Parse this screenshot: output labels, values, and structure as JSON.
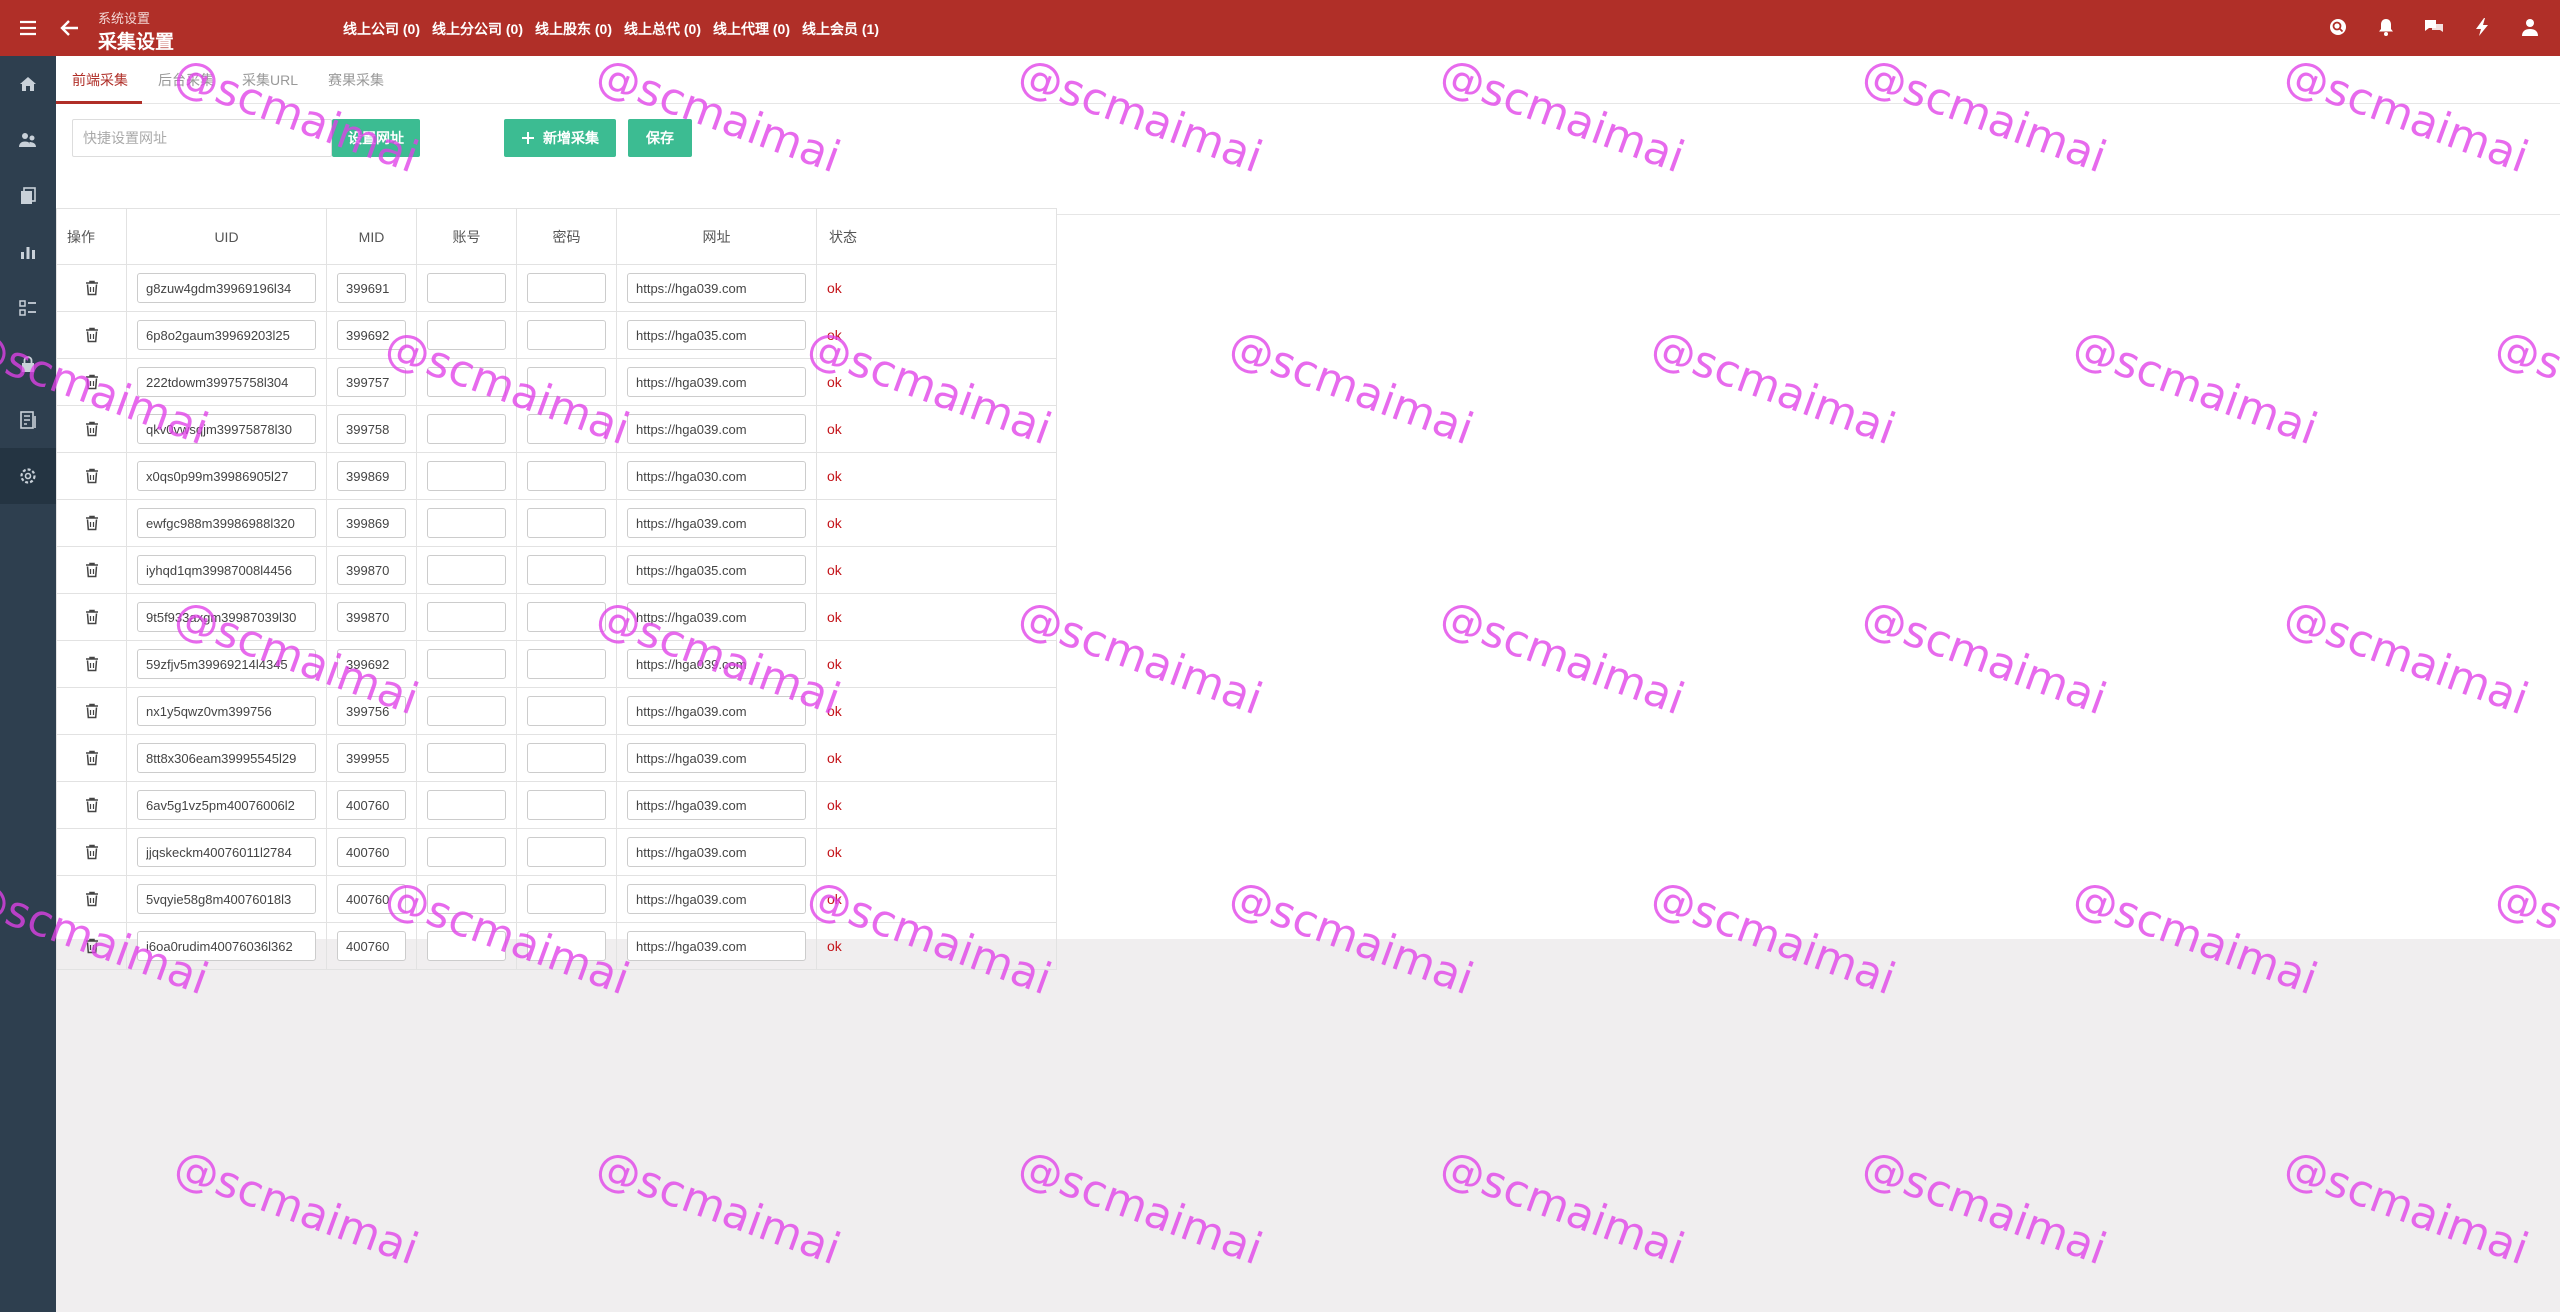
{
  "header": {
    "breadcrumb": "系统设置",
    "title": "采集设置",
    "counts": [
      "线上公司 (0)",
      "线上分公司 (0)",
      "线上股东 (0)",
      "线上总代 (0)",
      "线上代理 (0)",
      "线上会员 (1)"
    ],
    "icons": [
      "search-icon",
      "bell-icon",
      "chat-icon",
      "bolt-icon",
      "user-icon"
    ]
  },
  "sidebar": {
    "items": [
      "home-icon",
      "users-icon",
      "copy-icon",
      "chart-icon",
      "list-icon",
      "lock-icon",
      "book-icon",
      "settings-icon"
    ],
    "active_index": 7
  },
  "tabs": [
    {
      "label": "前端采集",
      "active": true
    },
    {
      "label": "后台采集",
      "active": false
    },
    {
      "label": "采集URL",
      "active": false
    },
    {
      "label": "赛果采集",
      "active": false
    }
  ],
  "toolbar": {
    "quick_url_placeholder": "快捷设置网址",
    "set_url_label": "设置网址",
    "add_label": "新增采集",
    "save_label": "保存"
  },
  "table": {
    "headers": [
      "操作",
      "UID",
      "MID",
      "账号",
      "密码",
      "网址",
      "状态"
    ],
    "rows": [
      {
        "uid": "g8zuw4gdm39969196l34",
        "mid": "399691",
        "account": "",
        "password": "",
        "url": "https://hga039.com",
        "status": "ok"
      },
      {
        "uid": "6p8o2gaum39969203l25",
        "mid": "399692",
        "account": "",
        "password": "",
        "url": "https://hga035.com",
        "status": "ok"
      },
      {
        "uid": "222tdowm39975758l304",
        "mid": "399757",
        "account": "",
        "password": "",
        "url": "https://hga039.com",
        "status": "ok"
      },
      {
        "uid": "qkv0vwsqjm39975878l30",
        "mid": "399758",
        "account": "",
        "password": "",
        "url": "https://hga039.com",
        "status": "ok"
      },
      {
        "uid": "x0qs0p99m39986905l27",
        "mid": "399869",
        "account": "",
        "password": "",
        "url": "https://hga030.com",
        "status": "ok"
      },
      {
        "uid": "ewfgc988m39986988l320",
        "mid": "399869",
        "account": "",
        "password": "",
        "url": "https://hga039.com",
        "status": "ok"
      },
      {
        "uid": "iyhqd1qm39987008l4456",
        "mid": "399870",
        "account": "",
        "password": "",
        "url": "https://hga035.com",
        "status": "ok"
      },
      {
        "uid": "9t5f933axgm39987039l30",
        "mid": "399870",
        "account": "",
        "password": "",
        "url": "https://hga039.com",
        "status": "ok"
      },
      {
        "uid": "59zfjv5m39969214l4345",
        "mid": "399692",
        "account": "",
        "password": "",
        "url": "https://hga039.com",
        "status": "ok"
      },
      {
        "uid": "nx1y5qwz0vm399756",
        "mid": "399756",
        "account": "",
        "password": "",
        "url": "https://hga039.com",
        "status": "ok"
      },
      {
        "uid": "8tt8x306eam39995545l29",
        "mid": "399955",
        "account": "",
        "password": "",
        "url": "https://hga039.com",
        "status": "ok"
      },
      {
        "uid": "6av5g1vz5pm40076006l2",
        "mid": "400760",
        "account": "",
        "password": "",
        "url": "https://hga039.com",
        "status": "ok"
      },
      {
        "uid": "jjqskeckm40076011l2784",
        "mid": "400760",
        "account": "",
        "password": "",
        "url": "https://hga039.com",
        "status": "ok"
      },
      {
        "uid": "5vqyie58g8m40076018l3",
        "mid": "400760",
        "account": "",
        "password": "",
        "url": "https://hga039.com",
        "status": "ok"
      },
      {
        "uid": "i6oa0rudim40076036l362",
        "mid": "400760",
        "account": "",
        "password": "",
        "url": "https://hga039.com",
        "status": "ok"
      }
    ]
  },
  "watermark_text": "@scmaimai",
  "colors": {
    "header_bg": "#b02f28",
    "sidebar_bg": "#2e3f4f",
    "button_green": "#3cbc92",
    "status_ok": "#c4141a",
    "watermark": "#e040e8"
  }
}
